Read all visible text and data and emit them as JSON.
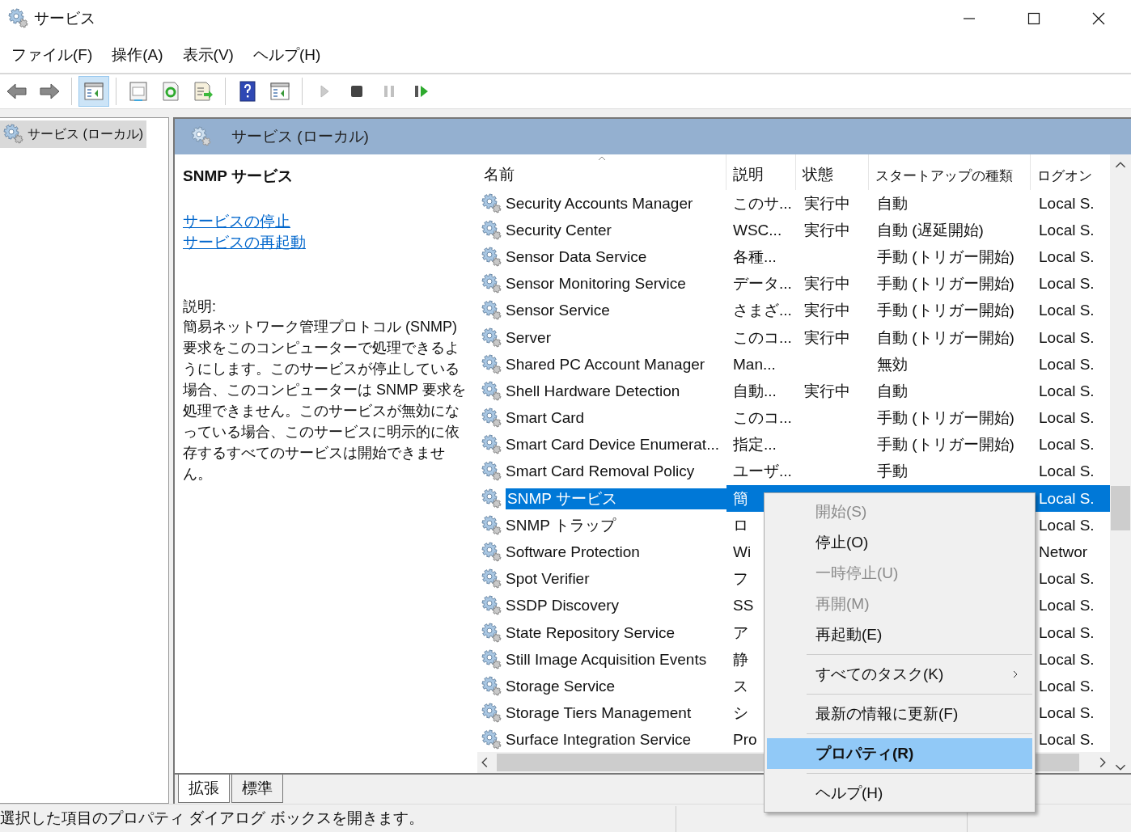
{
  "window": {
    "title": "サービス"
  },
  "menu": [
    "ファイル(F)",
    "操作(A)",
    "表示(V)",
    "ヘルプ(H)"
  ],
  "toolbar": [
    {
      "kind": "back",
      "selected": false,
      "disabled": false
    },
    {
      "kind": "forward",
      "selected": false,
      "disabled": false
    },
    {
      "kind": "console-tree",
      "selected": true,
      "disabled": false
    },
    {
      "kind": "properties",
      "selected": false,
      "disabled": false
    },
    {
      "kind": "refresh",
      "selected": false,
      "disabled": false
    },
    {
      "kind": "export",
      "selected": false,
      "disabled": false
    },
    {
      "kind": "help",
      "selected": false,
      "disabled": false
    },
    {
      "kind": "action-pane",
      "selected": false,
      "disabled": false
    },
    {
      "kind": "play",
      "selected": false,
      "disabled": true
    },
    {
      "kind": "stop",
      "selected": false,
      "disabled": false
    },
    {
      "kind": "pause",
      "selected": false,
      "disabled": true
    },
    {
      "kind": "resume",
      "selected": false,
      "disabled": false
    }
  ],
  "tree": {
    "items": [
      {
        "label": "サービス (ローカル)",
        "selected": true
      }
    ]
  },
  "panel": {
    "title": "サービス (ローカル)",
    "service_name": "SNMP サービス",
    "links": [
      "サービスの停止",
      "サービスの再起動"
    ],
    "description_label": "説明:",
    "description": "簡易ネットワーク管理プロトコル (SNMP) 要求をこのコンピューターで処理できるようにします。このサービスが停止している場合、このコンピューターは SNMP 要求を処理できません。このサービスが無効になっている場合、このサービスに明示的に依存するすべてのサービスは開始できません。"
  },
  "table": {
    "columns": [
      {
        "label": "名前",
        "sorted": true
      },
      {
        "label": "説明",
        "sorted": false
      },
      {
        "label": "状態",
        "sorted": false
      },
      {
        "label": "スタートアップの種類",
        "sorted": false
      },
      {
        "label": "ログオン",
        "sorted": false
      }
    ],
    "rows": [
      {
        "name": "Security Accounts Manager",
        "description": "このサ...",
        "status": "実行中",
        "startup": "自動",
        "logon": "Local S.",
        "selected": false
      },
      {
        "name": "Security Center",
        "description": "WSC...",
        "status": "実行中",
        "startup": "自動 (遅延開始)",
        "logon": "Local S.",
        "selected": false
      },
      {
        "name": "Sensor Data Service",
        "description": "各種...",
        "startup": "手動 (トリガー開始)",
        "logon": "Local S.",
        "selected": false
      },
      {
        "name": "Sensor Monitoring Service",
        "description": "データ...",
        "status": "実行中",
        "startup": "手動 (トリガー開始)",
        "logon": "Local S.",
        "selected": false
      },
      {
        "name": "Sensor Service",
        "description": "さまざ...",
        "status": "実行中",
        "startup": "手動 (トリガー開始)",
        "logon": "Local S.",
        "selected": false
      },
      {
        "name": "Server",
        "description": "このコ...",
        "status": "実行中",
        "startup": "自動 (トリガー開始)",
        "logon": "Local S.",
        "selected": false
      },
      {
        "name": "Shared PC Account Manager",
        "description": "Man...",
        "startup": "無効",
        "logon": "Local S.",
        "selected": false
      },
      {
        "name": "Shell Hardware Detection",
        "description": "自動...",
        "status": "実行中",
        "startup": "自動",
        "logon": "Local S.",
        "selected": false
      },
      {
        "name": "Smart Card",
        "description": "このコ...",
        "startup": "手動 (トリガー開始)",
        "logon": "Local S.",
        "selected": false
      },
      {
        "name": "Smart Card Device Enumerat...",
        "description": "指定...",
        "startup": "手動 (トリガー開始)",
        "logon": "Local S.",
        "selected": false
      },
      {
        "name": "Smart Card Removal Policy",
        "description": "ユーザ...",
        "startup": "手動",
        "logon": "Local S.",
        "selected": false
      },
      {
        "name": "SNMP サービス",
        "description": "簡",
        "logon": "Local S.",
        "selected": true
      },
      {
        "name": "SNMP トラップ",
        "description": "ロ",
        "logon": "Local S.",
        "selected": false
      },
      {
        "name": "Software Protection",
        "description": "Wi",
        "logon": "Networ",
        "selected": false
      },
      {
        "name": "Spot Verifier",
        "description": "フ",
        "logon": "Local S.",
        "selected": false
      },
      {
        "name": "SSDP Discovery",
        "description": "SS",
        "logon": "Local S.",
        "selected": false
      },
      {
        "name": "State Repository Service",
        "description": "ア",
        "logon": "Local S.",
        "selected": false
      },
      {
        "name": "Still Image Acquisition Events",
        "description": "静",
        "logon": "Local S.",
        "selected": false
      },
      {
        "name": "Storage Service",
        "description": "ス",
        "logon": "Local S.",
        "selected": false
      },
      {
        "name": "Storage Tiers Management",
        "description": "シ",
        "logon": "Local S.",
        "selected": false
      },
      {
        "name": "Surface Integration Service",
        "description": "Pro",
        "logon": "Local S.",
        "selected": false
      }
    ]
  },
  "context_menu": {
    "items": [
      {
        "kind": "item",
        "label": "開始(S)",
        "disabled": true,
        "selected": false
      },
      {
        "kind": "item",
        "label": "停止(O)",
        "disabled": false,
        "selected": false
      },
      {
        "kind": "item",
        "label": "一時停止(U)",
        "disabled": true,
        "selected": false
      },
      {
        "kind": "item",
        "label": "再開(M)",
        "disabled": true,
        "selected": false
      },
      {
        "kind": "item",
        "label": "再起動(E)",
        "disabled": false,
        "selected": false
      },
      {
        "kind": "separator"
      },
      {
        "kind": "submenu",
        "label": "すべてのタスク(K)",
        "disabled": false,
        "selected": false
      },
      {
        "kind": "separator"
      },
      {
        "kind": "item",
        "label": "最新の情報に更新(F)",
        "disabled": false,
        "selected": false
      },
      {
        "kind": "separator"
      },
      {
        "kind": "item",
        "label": "プロパティ(R)",
        "disabled": false,
        "selected": true,
        "bold": true
      },
      {
        "kind": "separator"
      },
      {
        "kind": "item",
        "label": "ヘルプ(H)",
        "disabled": false,
        "selected": false
      }
    ]
  },
  "view_tabs": [
    {
      "label": "拡張",
      "selected": true
    },
    {
      "label": "標準",
      "selected": false
    }
  ],
  "status_bar": "選択した項目のプロパティ ダイアログ ボックスを開きます。"
}
